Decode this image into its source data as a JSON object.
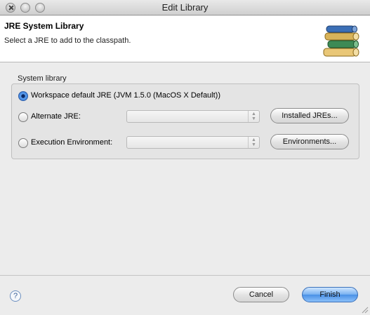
{
  "window": {
    "title": "Edit Library"
  },
  "header": {
    "title": "JRE System Library",
    "subtitle": "Select a JRE to add to the classpath.",
    "icon": "library-books-icon"
  },
  "system_library": {
    "group_label": "System library",
    "options": [
      {
        "label": "Workspace default JRE (JVM 1.5.0 (MacOS X Default))",
        "selected": true
      },
      {
        "label": "Alternate JRE:",
        "selected": false,
        "combo_value": "",
        "button_label": "Installed JREs..."
      },
      {
        "label": "Execution Environment:",
        "selected": false,
        "combo_value": "",
        "button_label": "Environments..."
      }
    ]
  },
  "footer": {
    "help_icon": "help-icon",
    "cancel_label": "Cancel",
    "finish_label": "Finish"
  },
  "colors": {
    "accent": "#4a90e6",
    "background": "#ececec"
  }
}
